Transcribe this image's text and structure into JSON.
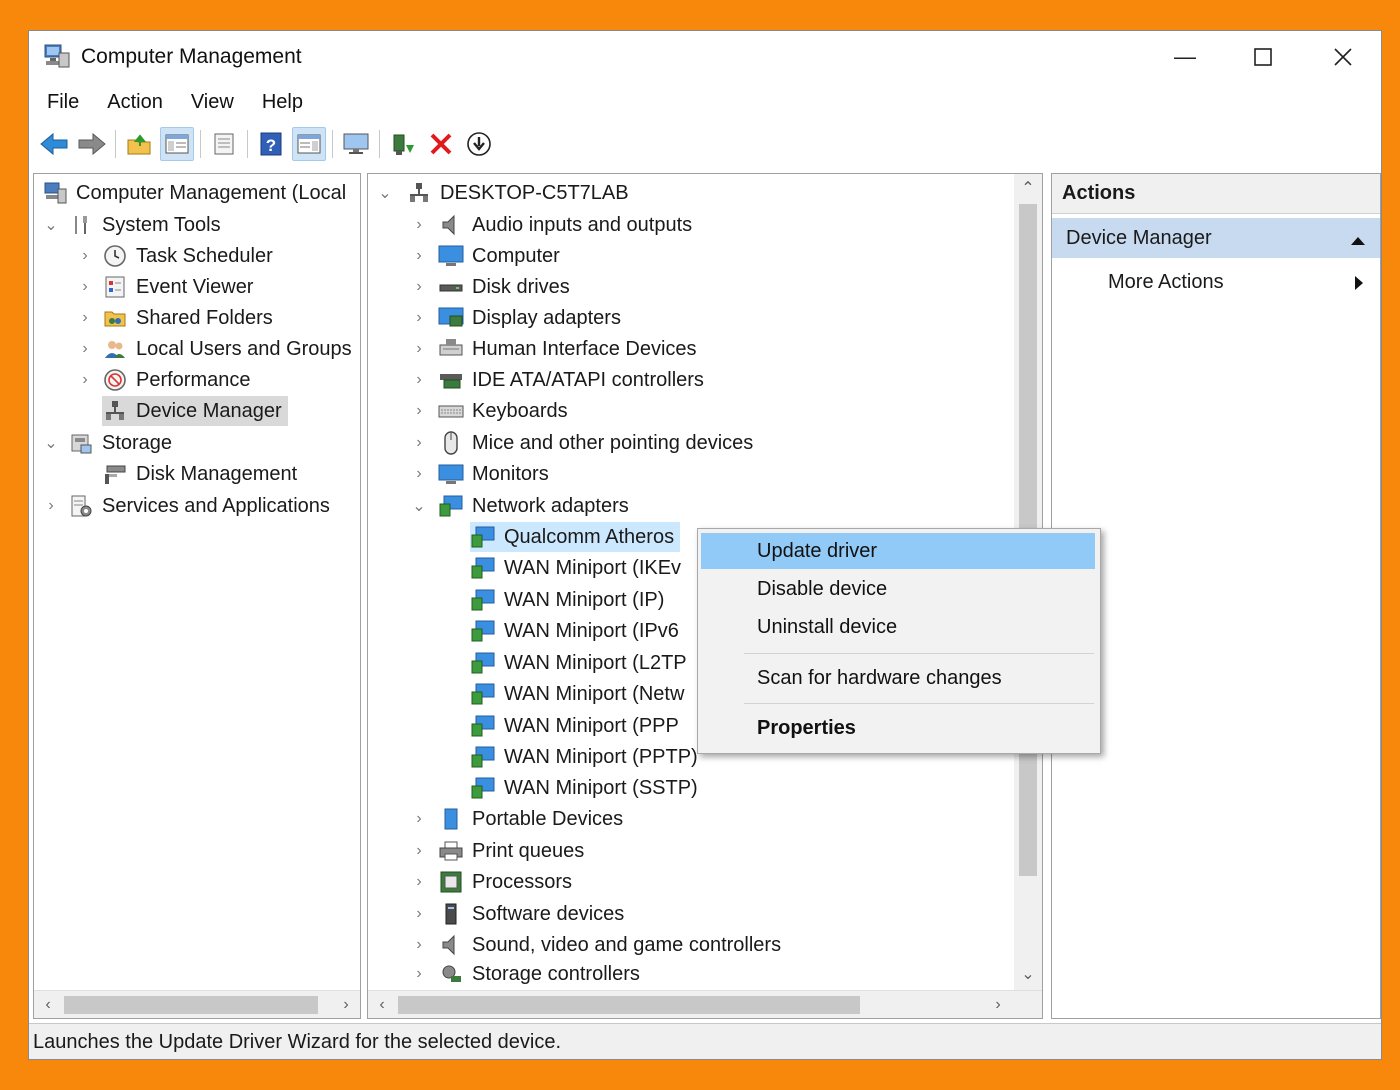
{
  "window": {
    "title": "Computer Management"
  },
  "menu": [
    "File",
    "Action",
    "View",
    "Help"
  ],
  "toolbar": {
    "buttons": [
      "back-icon",
      "forward-icon",
      "up-folder-icon",
      "show-hide-tree-icon",
      "export-list-icon",
      "help-icon",
      "show-hide-action-pane-icon",
      "monitor-icon",
      "update-driver-icon",
      "uninstall-icon",
      "download-icon"
    ]
  },
  "left_tree": {
    "root": "Computer Management (Local",
    "system_tools": "System Tools",
    "task_scheduler": "Task Scheduler",
    "event_viewer": "Event Viewer",
    "shared_folders": "Shared Folders",
    "local_users": "Local Users and Groups",
    "performance": "Performance",
    "device_manager": "Device Manager",
    "storage": "Storage",
    "disk_management": "Disk Management",
    "services": "Services and Applications"
  },
  "device_tree": {
    "root": "DESKTOP-C5T7LAB",
    "categories_top": [
      "Audio inputs and outputs",
      "Computer",
      "Disk drives",
      "Display adapters",
      "Human Interface Devices",
      "IDE ATA/ATAPI controllers",
      "Keyboards",
      "Mice and other pointing devices",
      "Monitors"
    ],
    "network_adapters": "Network adapters",
    "adapters": [
      "Qualcomm Atheros",
      "WAN Miniport (IKEv",
      "WAN Miniport (IP)",
      "WAN Miniport (IPv6",
      "WAN Miniport (L2TP",
      "WAN Miniport (Netw",
      "WAN Miniport (PPP",
      "WAN Miniport (PPTP)",
      "WAN Miniport (SSTP)"
    ],
    "categories_bottom": [
      "Portable Devices",
      "Print queues",
      "Processors",
      "Software devices",
      "Sound, video and game controllers",
      "Storage controllers"
    ]
  },
  "context_menu": {
    "update_driver": "Update driver",
    "disable_device": "Disable device",
    "uninstall_device": "Uninstall device",
    "scan": "Scan for hardware changes",
    "properties": "Properties"
  },
  "actions": {
    "header": "Actions",
    "section": "Device Manager",
    "more": "More Actions"
  },
  "status": "Launches the Update Driver Wizard for the selected device.",
  "colors": {
    "frame": "#f7880c",
    "selection": "#cce8ff",
    "menu_highlight": "#91c9f7",
    "section_header": "#c7daf0"
  }
}
